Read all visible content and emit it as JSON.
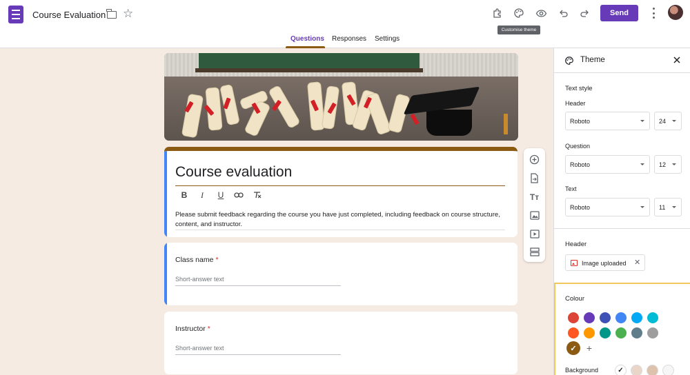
{
  "header": {
    "title": "Course Evaluation",
    "icons": [
      "folder-icon",
      "star-icon",
      "addons-icon",
      "palette-icon",
      "preview-eye-icon",
      "undo-icon",
      "redo-icon",
      "more-vert-icon"
    ],
    "send_label": "Send",
    "tooltip": "Customise theme"
  },
  "tabs": [
    {
      "label": "Questions",
      "active": true
    },
    {
      "label": "Responses"
    },
    {
      "label": "Settings"
    }
  ],
  "form": {
    "title": "Course evaluation",
    "description": "Please submit feedback regarding the course you have just completed, including feedback on course structure, content, and instructor.",
    "format_icons": [
      "bold-icon",
      "italic-icon",
      "underline-icon",
      "link-icon",
      "clear-format-icon"
    ],
    "questions": [
      {
        "title": "Class name",
        "required": "*",
        "placeholder": "Short-answer text"
      },
      {
        "title": "Instructor",
        "required": "*",
        "placeholder": "Short-answer text"
      }
    ]
  },
  "float_toolbar": [
    "add-question-icon",
    "import-questions-icon",
    "add-title-icon",
    "add-image-icon",
    "add-video-icon",
    "add-section-icon"
  ],
  "theme_panel": {
    "title": "Theme",
    "text_style_heading": "Text style",
    "fields": [
      {
        "label": "Header",
        "font": "Roboto",
        "size": "24"
      },
      {
        "label": "Question",
        "font": "Roboto",
        "size": "12"
      },
      {
        "label": "Text",
        "font": "Roboto",
        "size": "11"
      }
    ],
    "header_heading": "Header",
    "header_chip": "Image uploaded",
    "colour_heading": "Colour",
    "colours": [
      "#db4437",
      "#673ab7",
      "#3f51b5",
      "#4285f4",
      "#03a9f4",
      "#00bcd4",
      "#ff5722",
      "#ff9800",
      "#009688",
      "#4caf50",
      "#607d8b",
      "#9e9e9e",
      "#8b5a13"
    ],
    "selected_colour": "#8b5a13",
    "background_label": "Background",
    "backgrounds": [
      "#f6ebe3",
      "#ead6c8",
      "#ddc2ad",
      "#f6f6f6"
    ],
    "selected_background": "#f6ebe3"
  }
}
